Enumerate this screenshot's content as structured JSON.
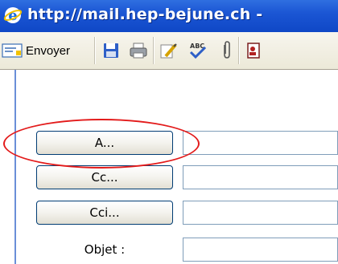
{
  "window": {
    "title": "http://mail.hep-bejune.ch - "
  },
  "toolbar": {
    "send_label": "Envoyer"
  },
  "form": {
    "to_button": "A...",
    "cc_button": "Cc...",
    "bcc_button": "Cci...",
    "subject_label": "Objet :",
    "to_value": "",
    "cc_value": "",
    "bcc_value": "",
    "subject_value": ""
  },
  "colors": {
    "title_bar": "#1b56d4",
    "highlight": "#e31b1b"
  }
}
